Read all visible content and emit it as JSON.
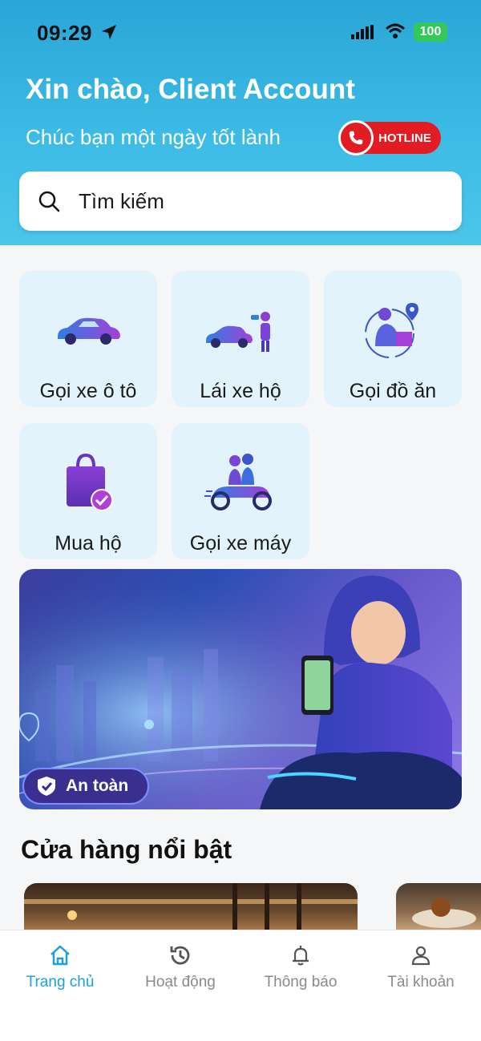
{
  "status_bar": {
    "time": "09:29",
    "battery": "100"
  },
  "header": {
    "greeting": "Xin chào, Client Account",
    "subtitle": "Chúc bạn một ngày tốt lành",
    "hotline_label": "HOTLINE"
  },
  "search": {
    "placeholder": "Tìm kiếm"
  },
  "services": [
    {
      "label": "Gọi xe ô tô",
      "icon": "car-icon"
    },
    {
      "label": "Lái xe hộ",
      "icon": "driver-icon"
    },
    {
      "label": "Gọi đồ ăn",
      "icon": "food-delivery-icon"
    },
    {
      "label": "Mua hộ",
      "icon": "shopping-bag-icon"
    },
    {
      "label": "Gọi xe máy",
      "icon": "motorbike-icon"
    }
  ],
  "banner": {
    "badge_label": "An toàn"
  },
  "featured": {
    "title": "Cửa hàng nổi bật"
  },
  "bottom_nav": [
    {
      "label": "Trang chủ",
      "icon": "home-icon",
      "active": true
    },
    {
      "label": "Hoạt động",
      "icon": "history-icon",
      "active": false
    },
    {
      "label": "Thông báo",
      "icon": "bell-icon",
      "active": false
    },
    {
      "label": "Tài khoản",
      "icon": "user-icon",
      "active": false
    }
  ],
  "colors": {
    "accent": "#1ba1d8",
    "header": "#3cbbe6",
    "hotline": "#e31b23",
    "tile": "#e3f3fb"
  }
}
